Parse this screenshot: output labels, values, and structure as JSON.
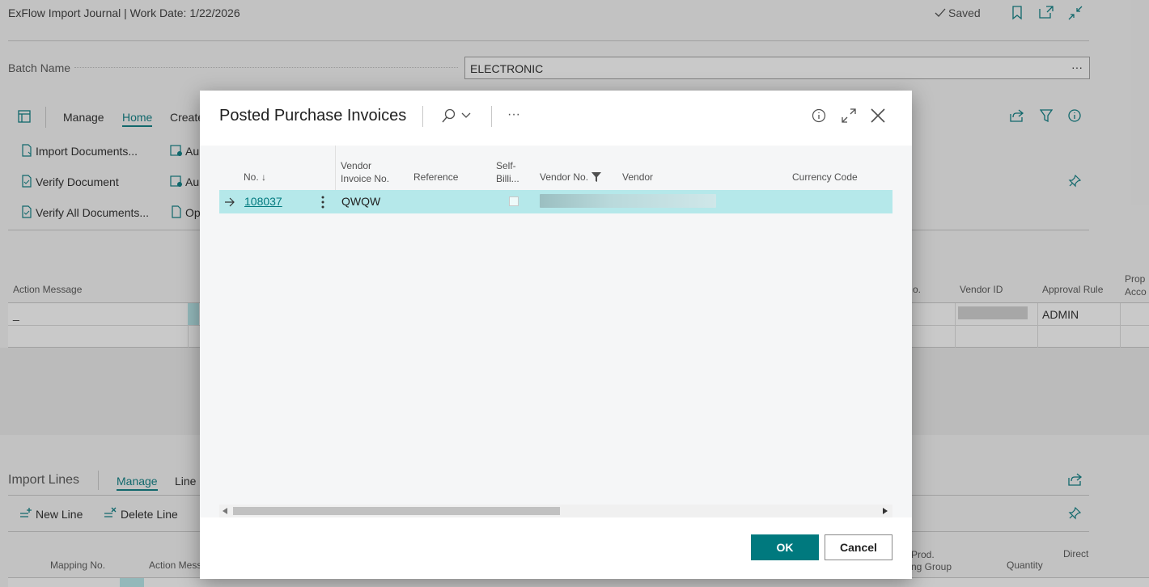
{
  "page": {
    "title": "ExFlow Import Journal | Work Date: 1/22/2026",
    "saved_label": "Saved",
    "batch_label": "Batch Name",
    "batch_value": "ELECTRONIC",
    "batch_more": "···"
  },
  "action_bar": {
    "manage": "Manage",
    "home": "Home",
    "create": "Create",
    "actions": [
      "Import Documents...",
      "Verify Document",
      "Verify All Documents..."
    ],
    "actions_col2": [
      "Au",
      "Au",
      "Op"
    ]
  },
  "header_grid": {
    "columns": [
      "Action Message",
      "o.",
      "Vendor ID",
      "Approval Rule",
      "Prop Acco"
    ],
    "row1": {
      "action_message": "_",
      "approval_rule": "ADMIN"
    }
  },
  "import_lines": {
    "title": "Import Lines",
    "tabs": [
      "Manage",
      "Line"
    ],
    "actions": [
      "New Line",
      "Delete Line"
    ],
    "columns": [
      "Mapping No.",
      "Action Mess",
      "Prod.",
      "ng Group",
      "Quantity",
      "Direct"
    ]
  },
  "dialog": {
    "title": "Posted Purchase Invoices",
    "more": "···",
    "columns": {
      "no": "No. ↓",
      "vendor_invoice_no_1": "Vendor",
      "vendor_invoice_no_2": "Invoice No.",
      "reference": "Reference",
      "self_billing_1": "Self-",
      "self_billing_2": "Billi...",
      "vendor_no": "Vendor No.",
      "vendor": "Vendor",
      "currency_code": "Currency Code"
    },
    "rows": [
      {
        "no": "108037",
        "vendor_invoice_no": "QWQW",
        "reference": "",
        "self_billing": false,
        "vendor_no": "",
        "vendor": "",
        "currency_code": ""
      }
    ],
    "ok_label": "OK",
    "cancel_label": "Cancel"
  }
}
